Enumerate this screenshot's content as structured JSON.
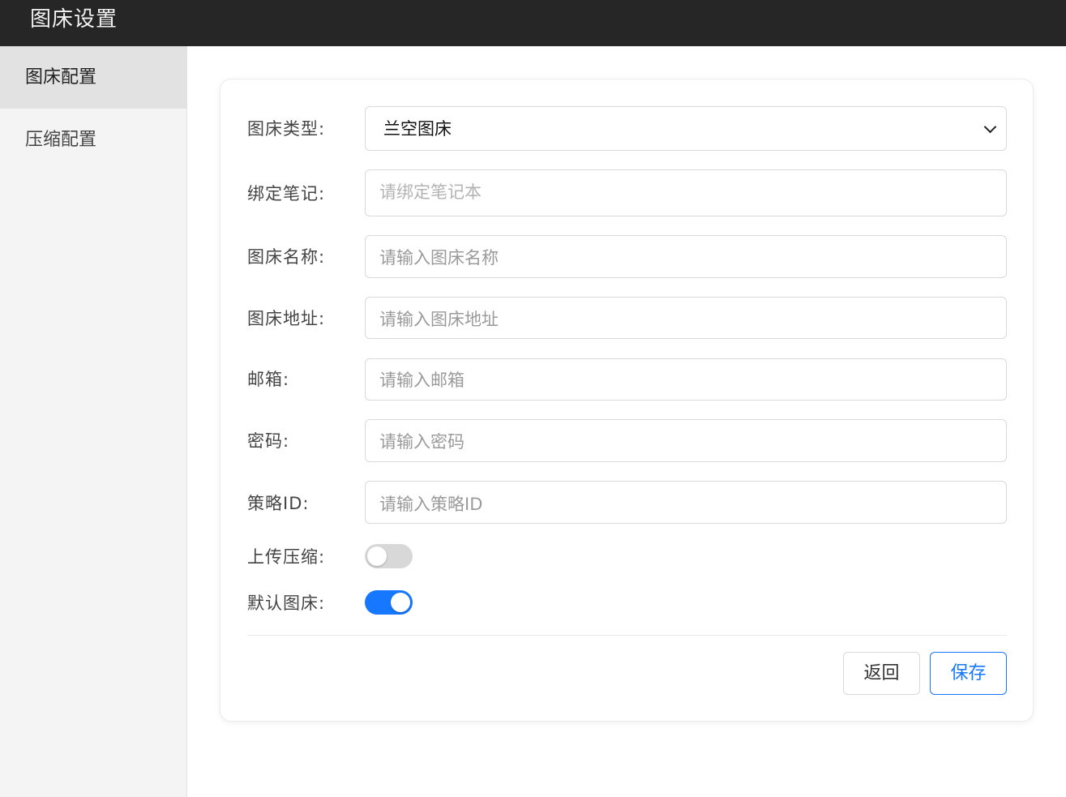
{
  "header": {
    "title": "图床设置"
  },
  "sidebar": {
    "items": [
      {
        "label": "图床配置",
        "active": true
      },
      {
        "label": "压缩配置",
        "active": false
      }
    ]
  },
  "form": {
    "type": {
      "label": "图床类型:",
      "value": "兰空图床"
    },
    "notebook": {
      "label": "绑定笔记:",
      "placeholder": "请绑定笔记本"
    },
    "name": {
      "label": "图床名称:",
      "placeholder": "请输入图床名称"
    },
    "url": {
      "label": "图床地址:",
      "placeholder": "请输入图床地址"
    },
    "email": {
      "label": "邮箱:",
      "placeholder": "请输入邮箱"
    },
    "password": {
      "label": "密码:",
      "placeholder": "请输入密码"
    },
    "strategy": {
      "label": "策略ID:",
      "placeholder": "请输入策略ID"
    },
    "compress": {
      "label": "上传压缩:",
      "on": false
    },
    "default": {
      "label": "默认图床:",
      "on": true
    }
  },
  "actions": {
    "back_label": "返回",
    "save_label": "保存"
  },
  "colors": {
    "accent": "#1677ff",
    "topbar": "#262626",
    "sidebar": "#f4f4f4"
  }
}
